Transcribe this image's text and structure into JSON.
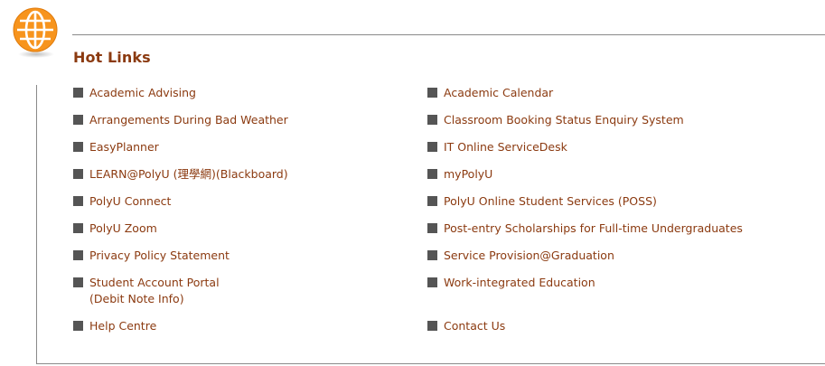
{
  "section": {
    "title": "Hot Links",
    "icon": "globe-icon",
    "accent_color": "#f08a1c",
    "title_color": "#8b3a10"
  },
  "links": {
    "left": [
      {
        "label": "Academic Advising"
      },
      {
        "label": "Arrangements During Bad Weather"
      },
      {
        "label": "EasyPlanner"
      },
      {
        "label": "LEARN@PolyU (理學網)(Blackboard)"
      },
      {
        "label": "PolyU Connect"
      },
      {
        "label": "PolyU Zoom"
      },
      {
        "label": "Privacy Policy Statement"
      },
      {
        "label": "Student Account Portal",
        "sub": "(Debit Note Info)"
      },
      {
        "label": "Help Centre"
      }
    ],
    "right": [
      {
        "label": "Academic Calendar"
      },
      {
        "label": "Classroom Booking Status Enquiry System"
      },
      {
        "label": "IT Online ServiceDesk"
      },
      {
        "label": "myPolyU"
      },
      {
        "label": "PolyU Online Student Services (POSS)"
      },
      {
        "label": "Post-entry Scholarships for Full-time Undergraduates"
      },
      {
        "label": "Service Provision@Graduation"
      },
      {
        "label": "Work-integrated Education"
      },
      {
        "label": "Contact Us"
      }
    ]
  }
}
